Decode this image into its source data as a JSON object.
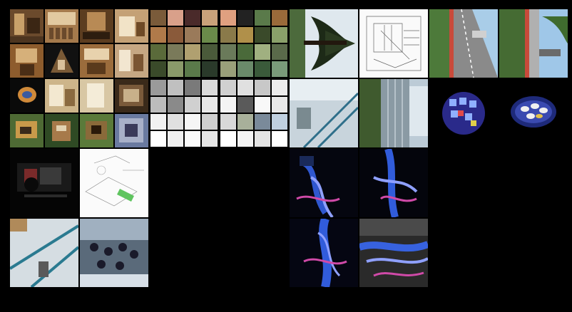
{
  "page": {
    "background": "#000000"
  },
  "gallery": {
    "tile_count": 24,
    "tiles": [
      {
        "id": "interior-collage"
      },
      {
        "id": "interior-thumb-grid"
      },
      {
        "id": "tree-photo"
      },
      {
        "id": "line-drawing"
      },
      {
        "id": "highway-photo"
      },
      {
        "id": "street-tree-photo"
      },
      {
        "id": "mixed-collage"
      },
      {
        "id": "sketch-grid"
      },
      {
        "id": "stair-photo"
      },
      {
        "id": "station-photo"
      },
      {
        "id": "glow-artifact-1"
      },
      {
        "id": "glow-artifact-2"
      },
      {
        "id": "dark-room-photo"
      },
      {
        "id": "site-plan-drawing"
      },
      {
        "id": "light-trails-1"
      },
      {
        "id": "light-trails-2"
      },
      {
        "id": "staircase-photo"
      },
      {
        "id": "crowd-photo"
      },
      {
        "id": "light-trails-3"
      },
      {
        "id": "light-trails-4"
      }
    ]
  },
  "palette": {
    "wood": "#8a5a2b",
    "sky": "#9fc7e8",
    "foliage": "#3f6b2e",
    "paper": "#f2f2f2",
    "glow_blue": "#3a6cff",
    "glow_pink": "#d04aa8"
  }
}
